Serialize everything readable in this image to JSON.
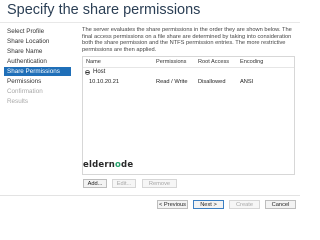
{
  "page": {
    "title": "Specify the share permissions"
  },
  "nav": {
    "items": [
      {
        "label": "Select Profile"
      },
      {
        "label": "Share Location"
      },
      {
        "label": "Share Name"
      },
      {
        "label": "Authentication"
      },
      {
        "label": "Share Permissions"
      },
      {
        "label": "Permissions"
      },
      {
        "label": "Confirmation"
      },
      {
        "label": "Results"
      }
    ]
  },
  "description": "The server evaluates the share permissions in the order they are shown below. The final access permissions on a file share are determined by taking into consideration both the share permission and the NTFS permission entries. The more restrictive permissions are then applied.",
  "table": {
    "columns": [
      "Name",
      "Permissions",
      "Root Access",
      "Encoding"
    ],
    "group": "Host",
    "rows": [
      {
        "name": "10.10.20.21",
        "permissions": "Read / Write",
        "root_access": "Disallowed",
        "encoding": "ANSI"
      }
    ]
  },
  "table_buttons": {
    "add": "Add...",
    "edit": "Edit...",
    "remove": "Remove"
  },
  "footer": {
    "previous": "< Previous",
    "next": "Next >",
    "create": "Create",
    "cancel": "Cancel"
  },
  "watermark": {
    "prefix": "eldern",
    "accent": "o",
    "suffix": "de"
  }
}
